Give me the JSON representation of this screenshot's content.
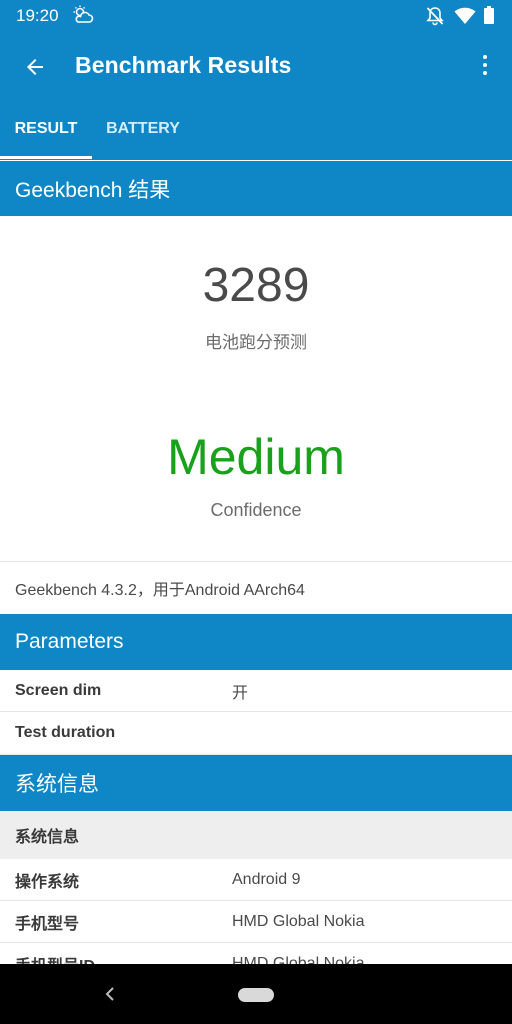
{
  "status_bar": {
    "time": "19:20",
    "icons": [
      "weather-cloud-sun-icon",
      "notifications-off-icon",
      "wifi-icon",
      "battery-icon"
    ]
  },
  "app_bar": {
    "title": "Benchmark Results",
    "back_icon": "arrow-left-icon",
    "menu_icon": "more-vert-icon",
    "tabs": [
      {
        "label": "RESULT",
        "selected": true
      },
      {
        "label": "BATTERY",
        "selected": false
      }
    ]
  },
  "sections": {
    "geekbench_header": "Geekbench 结果",
    "parameters_header": "Parameters",
    "sysinfo_header": "系统信息"
  },
  "result": {
    "score": "3289",
    "score_label": "电池跑分预测",
    "confidence": "Medium",
    "confidence_label": "Confidence",
    "version_line": "Geekbench 4.3.2，用于Android AArch64"
  },
  "parameters": [
    {
      "key": "Screen dim",
      "value": "开"
    },
    {
      "key": "Test duration",
      "value": ""
    }
  ],
  "system_info": {
    "subheader": "系统信息",
    "rows": [
      {
        "key": "操作系统",
        "value": "Android 9"
      },
      {
        "key": "手机型号",
        "value": "HMD Global Nokia"
      },
      {
        "key": "手机型号ID",
        "value": "HMD Global Nokia"
      }
    ]
  },
  "colors": {
    "primary": "#0f86c5",
    "confidence_green": "#19a11c",
    "subheader_bg": "#eeeeee"
  }
}
